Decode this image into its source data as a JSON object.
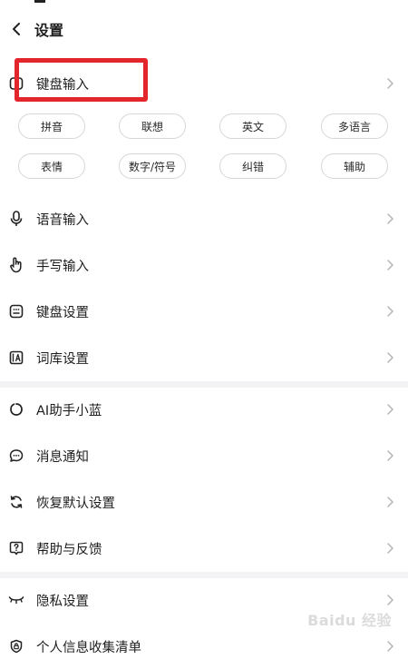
{
  "header": {
    "title": "设置",
    "back_icon": "chevron-left-icon"
  },
  "keyboard_section": {
    "title": "键盘输入",
    "icon": "keyboard-icon",
    "highlighted": true,
    "chips": [
      "拼音",
      "联想",
      "英文",
      "多语言",
      "表情",
      "数字/符号",
      "纠错",
      "辅助"
    ]
  },
  "items_group1": [
    {
      "label": "语音输入",
      "icon": "microphone-icon"
    },
    {
      "label": "手写输入",
      "icon": "hand-pointer-icon"
    },
    {
      "label": "键盘设置",
      "icon": "keyboard-settings-icon"
    },
    {
      "label": "词库设置",
      "icon": "dictionary-icon"
    }
  ],
  "items_group2": [
    {
      "label": "AI助手小蓝",
      "icon": "ai-assistant-icon"
    },
    {
      "label": "消息通知",
      "icon": "message-icon"
    },
    {
      "label": "恢复默认设置",
      "icon": "reset-icon"
    },
    {
      "label": "帮助与反馈",
      "icon": "help-icon"
    }
  ],
  "items_group3": [
    {
      "label": "隐私设置",
      "icon": "eye-closed-icon"
    },
    {
      "label": "个人信息收集清单",
      "icon": "privacy-lock-icon"
    }
  ],
  "watermark": "Baidu 经验",
  "colors": {
    "highlight": "#e3262b",
    "chevron": "#b5b5b5",
    "divider": "#f3f3f5"
  }
}
